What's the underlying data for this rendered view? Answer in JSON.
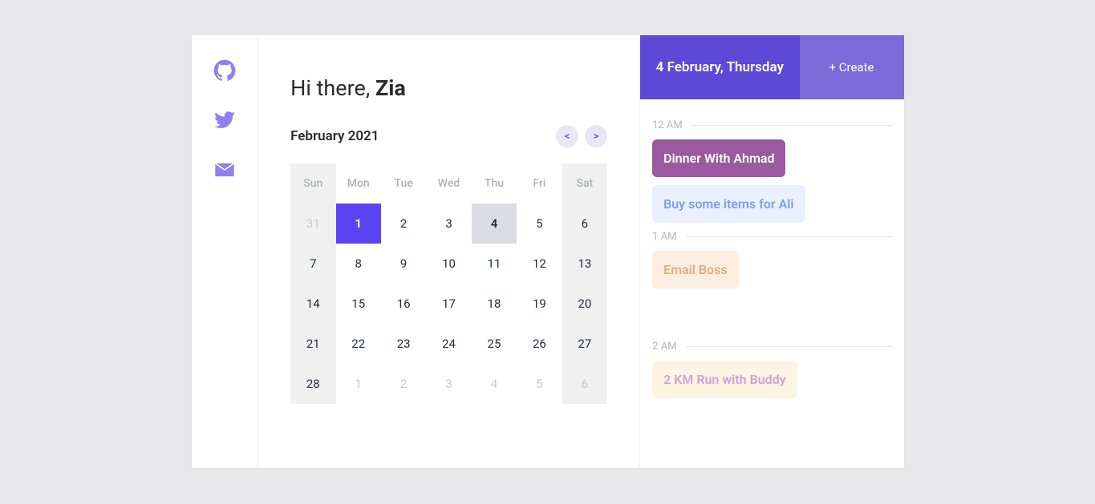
{
  "sidebar": {
    "github": "github-icon",
    "twitter": "twitter-icon",
    "mail": "mail-icon"
  },
  "greeting": {
    "prefix": "Hi there, ",
    "name": "Zia"
  },
  "calendar": {
    "month_label": "February 2021",
    "prev": "<",
    "next": ">",
    "headers": [
      "Sun",
      "Mon",
      "Tue",
      "Wed",
      "Thu",
      "Fri",
      "Sat"
    ],
    "weeks": [
      [
        {
          "n": "31",
          "muted": true
        },
        {
          "n": "1",
          "today": true
        },
        {
          "n": "2"
        },
        {
          "n": "3"
        },
        {
          "n": "4",
          "selected": true
        },
        {
          "n": "5"
        },
        {
          "n": "6"
        }
      ],
      [
        {
          "n": "7"
        },
        {
          "n": "8"
        },
        {
          "n": "9"
        },
        {
          "n": "10"
        },
        {
          "n": "11"
        },
        {
          "n": "12"
        },
        {
          "n": "13"
        }
      ],
      [
        {
          "n": "14"
        },
        {
          "n": "15"
        },
        {
          "n": "16"
        },
        {
          "n": "17"
        },
        {
          "n": "18"
        },
        {
          "n": "19"
        },
        {
          "n": "20"
        }
      ],
      [
        {
          "n": "21"
        },
        {
          "n": "22"
        },
        {
          "n": "23"
        },
        {
          "n": "24"
        },
        {
          "n": "25"
        },
        {
          "n": "26"
        },
        {
          "n": "27"
        }
      ],
      [
        {
          "n": "28"
        },
        {
          "n": "1",
          "muted": true
        },
        {
          "n": "2",
          "muted": true
        },
        {
          "n": "3",
          "muted": true
        },
        {
          "n": "4",
          "muted": true
        },
        {
          "n": "5",
          "muted": true
        },
        {
          "n": "6",
          "muted": true
        }
      ]
    ]
  },
  "events": {
    "date_label": "4 February, Thursday",
    "create_label": "+ Create",
    "hours": [
      {
        "label": "12 AM",
        "items": [
          {
            "text": "Dinner With Ahmad",
            "style": "ev-purple"
          },
          {
            "text": "Buy some items for Ali",
            "style": "ev-blue"
          }
        ]
      },
      {
        "label": "1 AM",
        "items": [
          {
            "text": "Email Boss",
            "style": "ev-peach"
          }
        ]
      },
      {
        "label": "2 AM",
        "items": [
          {
            "text": "2 KM Run with Buddy",
            "style": "ev-cream"
          }
        ]
      }
    ]
  }
}
